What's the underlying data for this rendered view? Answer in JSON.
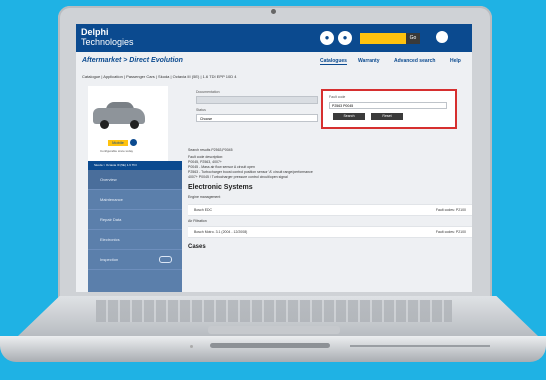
{
  "header": {
    "brand_line1": "Delphi",
    "brand_line2": "Technologies",
    "search_button": "Go"
  },
  "title": "Aftermarket > Direct Evolution",
  "nav": [
    "Catalogues",
    "Warranty",
    "Advanced search",
    "Help"
  ],
  "breadcrumb": "Catalogue | Application | Passenger Cars | Skoda | Octavia III (5E) | 1.6 TDI EPP 10D 4",
  "vehicle": {
    "badge": "Mobile",
    "subtext": "Configurable since today",
    "bar_text": "Skoda > Octavia III (5E) 1.6 TDI"
  },
  "menu": [
    "Overview",
    "Maintenance",
    "Repair Data",
    "Electronics",
    "Inspection"
  ],
  "filters": {
    "documentation_label": "Documentation",
    "documentation_value": "",
    "status_label": "Status",
    "status_value": "Choose"
  },
  "fault": {
    "label": "Fault code",
    "value": "P2563 P0045",
    "search": "Search",
    "reset": "Reset"
  },
  "results": {
    "search_line": "Search results P2563,P0045",
    "desc_title": "Fault code description:",
    "lines": [
      "P0045, P2563, 4007+",
      "P0045 - Mass air flow sensor A circuit open",
      "P2563 - Turbocharger boost control position sensor 'A' circuit range/performance",
      "4007+ P0045 / Turbocharger pressure control circuit/open signal"
    ]
  },
  "section": "Electronic Systems",
  "section_sub": "Engine management",
  "rows": [
    {
      "left": "Bosch EDC",
      "right": "Fault codes: P2100"
    },
    {
      "left": "Bosch Motro. 3.1 (2004 - 12/2008)",
      "right": "Fault codes: P2100"
    }
  ],
  "row_label_2": "Air Filtration",
  "section2": "Cases"
}
